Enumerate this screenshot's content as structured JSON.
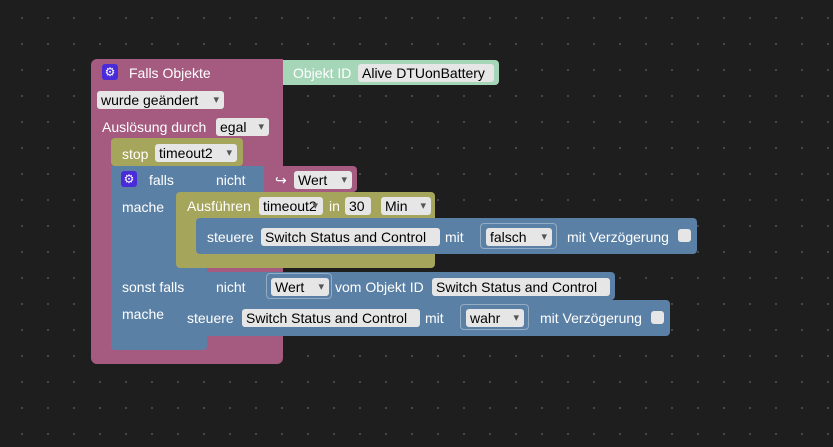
{
  "trigger": {
    "title": "Falls Objekte",
    "object_id_label": "Objekt ID",
    "object_id_value": "Alive DTUonBattery",
    "changed_value": "wurde geändert",
    "trigger_label": "Auslösung durch",
    "trigger_value": "egal"
  },
  "stop": {
    "label": "stop",
    "timer": "timeout2"
  },
  "if_block": {
    "if_label": "falls",
    "not_label": "nicht",
    "value_var": "Wert",
    "do_label": "mache",
    "else_if_label": "sonst falls",
    "else_do_label": "mache"
  },
  "run_block": {
    "label": "Ausführen",
    "timer": "timeout2",
    "in_label": "in",
    "amount": "30",
    "unit": "Min"
  },
  "control1": {
    "label": "steuere",
    "target": "Switch Status and Control",
    "with_label": "mit",
    "value": "falsch",
    "delay_label": "mit Verzögerung"
  },
  "else_cond": {
    "not_label": "nicht",
    "value_field": "Wert",
    "from_object_label": "vom Objekt ID",
    "object_value": "Switch Status and Control"
  },
  "control2": {
    "label": "steuere",
    "target": "Switch Status and Control",
    "with_label": "mit",
    "value": "wahr",
    "delay_label": "mit Verzögerung"
  },
  "colors": {
    "trigger": "#a55b80",
    "object_id": "#a5d6b8",
    "timer": "#a5a55b",
    "logic": "#5b80a5",
    "variable": "#a55b80",
    "background": "#1e1e1e"
  }
}
